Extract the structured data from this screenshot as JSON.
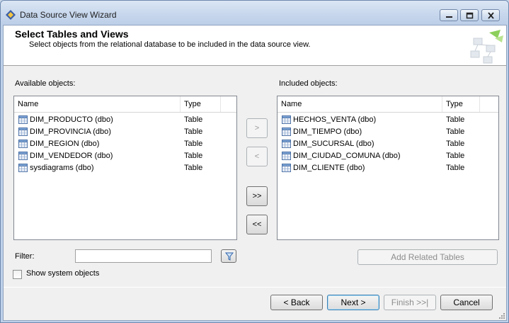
{
  "window": {
    "title": "Data Source View Wizard",
    "buttons": [
      "minimize-icon",
      "maximize-icon",
      "close-icon"
    ]
  },
  "header": {
    "title": "Select Tables and Views",
    "subtitle": "Select objects from the relational database to be included in the data source view."
  },
  "available": {
    "label": "Available objects:",
    "columns": {
      "name": "Name",
      "type": "Type"
    },
    "rows": [
      {
        "name": "DIM_PRODUCTO (dbo)",
        "type": "Table"
      },
      {
        "name": "DIM_PROVINCIA (dbo)",
        "type": "Table"
      },
      {
        "name": "DIM_REGION (dbo)",
        "type": "Table"
      },
      {
        "name": "DIM_VENDEDOR (dbo)",
        "type": "Table"
      },
      {
        "name": "sysdiagrams (dbo)",
        "type": "Table"
      }
    ]
  },
  "included": {
    "label": "Included objects:",
    "columns": {
      "name": "Name",
      "type": "Type"
    },
    "rows": [
      {
        "name": "HECHOS_VENTA (dbo)",
        "type": "Table"
      },
      {
        "name": "DIM_TIEMPO (dbo)",
        "type": "Table"
      },
      {
        "name": "DIM_SUCURSAL (dbo)",
        "type": "Table"
      },
      {
        "name": "DIM_CIUDAD_COMUNA (dbo)",
        "type": "Table"
      },
      {
        "name": "DIM_CLIENTE (dbo)",
        "type": "Table"
      }
    ]
  },
  "move_buttons": {
    "add_one": ">",
    "remove_one": "<",
    "add_all": ">>",
    "remove_all": "<<"
  },
  "filter": {
    "label": "Filter:",
    "value": "",
    "icon": "filter-icon"
  },
  "show_system_objects": {
    "label": "Show system objects",
    "checked": false
  },
  "add_related_tables": "Add Related Tables",
  "footer": {
    "back": "< Back",
    "next": "Next >",
    "finish": "Finish >>|",
    "cancel": "Cancel"
  },
  "colors": {
    "title_bar": "#c6d6ec",
    "dialog_bg": "#f0f0f0",
    "default_button_border": "#3c7fb1"
  }
}
